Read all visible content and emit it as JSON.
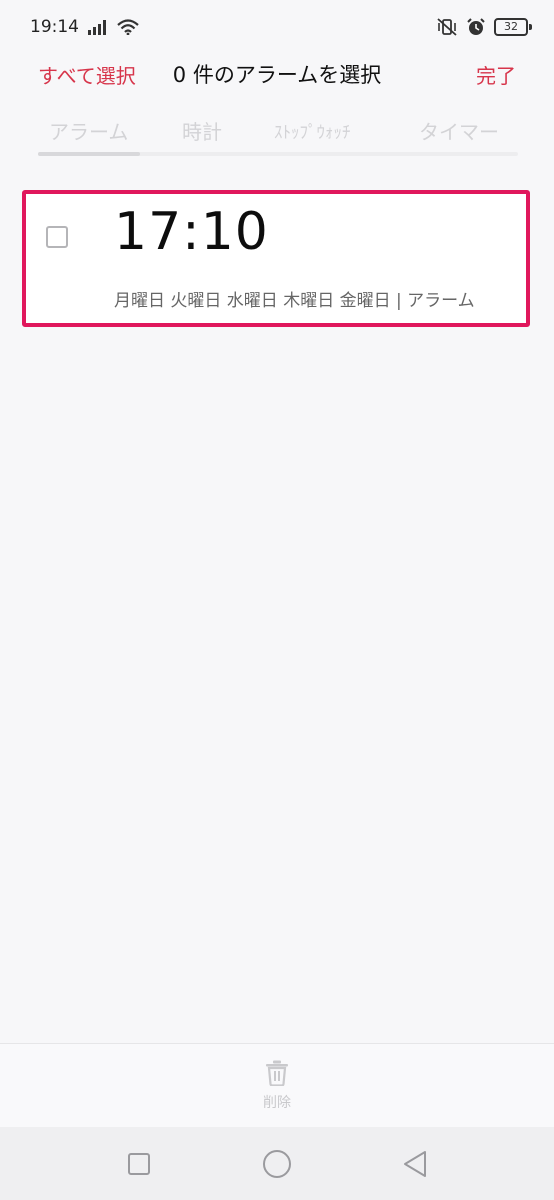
{
  "status_bar": {
    "time": "19:14",
    "battery_level": "32",
    "icons": [
      "signal-icon",
      "wifi-icon",
      "vibrate-off-icon",
      "alarm-icon",
      "battery-icon"
    ]
  },
  "header": {
    "select_all": "すべて選択",
    "title": "0 件のアラームを選択",
    "done": "完了"
  },
  "tabs": [
    {
      "label": "アラーム",
      "selected": true
    },
    {
      "label": "時計",
      "selected": false
    },
    {
      "label": "ｽﾄｯﾌﾟｳｫｯﾁ",
      "selected": false
    },
    {
      "label": "タイマー",
      "selected": false
    }
  ],
  "alarms": [
    {
      "time": "17:10",
      "repeat": "月曜日 火曜日 水曜日 木曜日 金曜日 | アラーム",
      "checked": false
    }
  ],
  "bottom_bar": {
    "delete_label": "削除"
  },
  "navigation": [
    "recents-icon",
    "home-icon",
    "back-icon"
  ],
  "colors": {
    "accent": "#d7354b",
    "highlight_border": "#e0175c",
    "background": "#f7f7f9",
    "muted_text": "#d3d3d6"
  }
}
